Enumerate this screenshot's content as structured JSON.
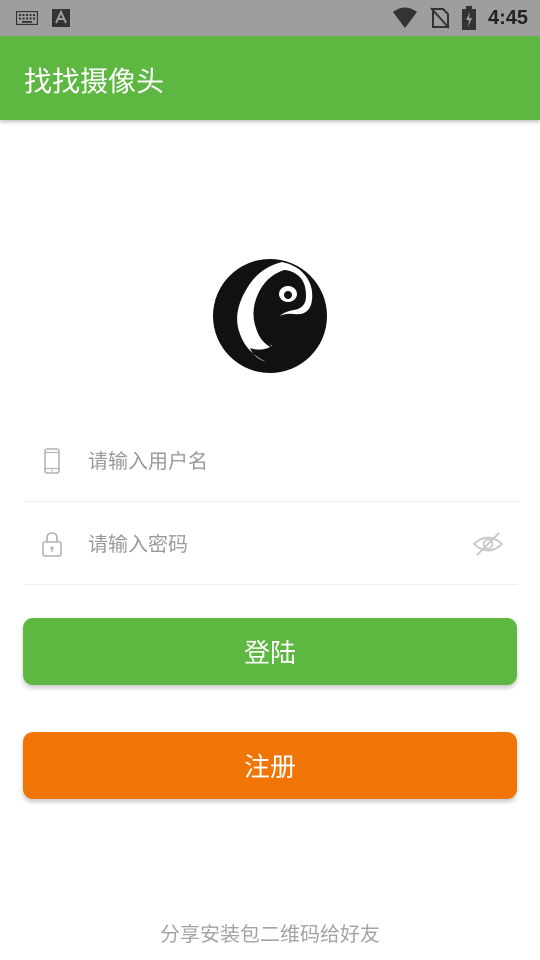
{
  "status_bar": {
    "time": "4:45",
    "icons": [
      "keyboard-icon",
      "text-a-icon",
      "wifi-icon",
      "no-sim-icon",
      "battery-charging-icon"
    ]
  },
  "app_bar": {
    "title": "找找摄像头"
  },
  "logo": {
    "icon": "dog-logo-icon"
  },
  "login_form": {
    "username": {
      "placeholder": "请输入用户名",
      "value": "",
      "icon": "phone-icon"
    },
    "password": {
      "placeholder": "请输入密码",
      "value": "",
      "icon": "lock-icon",
      "toggle_icon": "eye-hidden-icon"
    }
  },
  "buttons": {
    "login_label": "登陆",
    "register_label": "注册"
  },
  "footer": {
    "share_text": "分享安装包二维码给好友"
  },
  "colors": {
    "primary_green": "#5db741",
    "register_orange": "#f07406",
    "status_bar_gray": "#9e9e9e"
  }
}
